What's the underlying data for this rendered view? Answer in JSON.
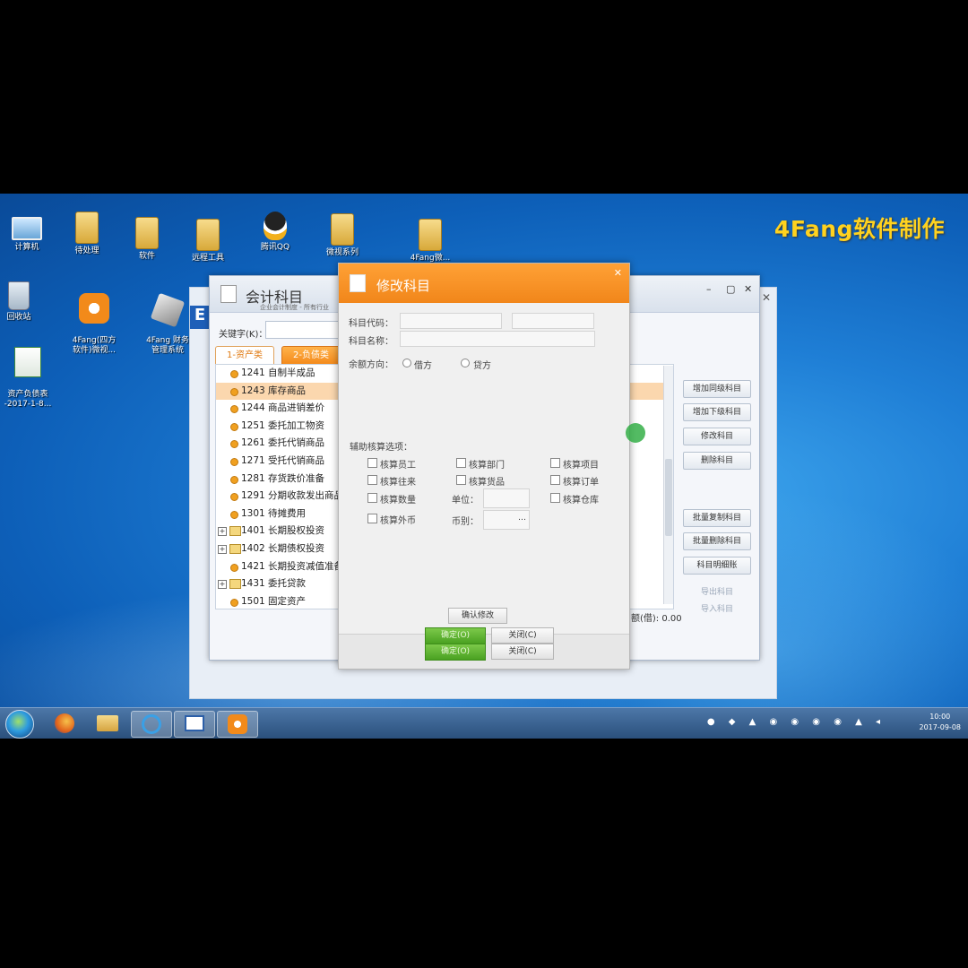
{
  "watermark": "4Fang软件制作",
  "desktop_icons": [
    {
      "label": "计算机",
      "icon": "computer-icon"
    },
    {
      "label": "待处理",
      "icon": "folder-icon"
    },
    {
      "label": "软件",
      "icon": "folder-icon"
    },
    {
      "label": "远程工具",
      "icon": "folder-icon"
    },
    {
      "label": "腾讯QQ",
      "icon": "qq-icon"
    },
    {
      "label": "微视系列",
      "icon": "folder-icon"
    },
    {
      "label": "4Fang微...",
      "icon": "folder-icon"
    },
    {
      "label": "回收站",
      "icon": "recycle-bin-icon"
    },
    {
      "label": "4Fang(四方\n软件)微视...",
      "icon": "app-icon"
    },
    {
      "label": "4Fang 财务\n管理系统",
      "icon": "app-icon"
    },
    {
      "label": "资产负债表\n-2017-1-8...",
      "icon": "excel-icon"
    }
  ],
  "main_window": {
    "title": "会计科目",
    "subtitle": "企业会计制度 - 所有行业",
    "keyword_label": "关键字(K)：",
    "tabs": [
      "1-资产类",
      "2-负债类"
    ],
    "rows": [
      {
        "code_name": "1241 自制半成品",
        "type": "leaf"
      },
      {
        "code_name": "1243 库存商品",
        "type": "leaf",
        "selected": true
      },
      {
        "code_name": "1244 商品进销差价",
        "type": "leaf"
      },
      {
        "code_name": "1251 委托加工物资",
        "type": "leaf"
      },
      {
        "code_name": "1261 委托代销商品",
        "type": "leaf"
      },
      {
        "code_name": "1271 受托代销商品",
        "type": "leaf"
      },
      {
        "code_name": "1281 存货跌价准备",
        "type": "leaf"
      },
      {
        "code_name": "1291 分期收款发出商品",
        "type": "leaf"
      },
      {
        "code_name": "1301 待摊费用",
        "type": "leaf"
      },
      {
        "code_name": "1401 长期股权投资",
        "type": "folder"
      },
      {
        "code_name": "1402 长期债权投资",
        "type": "folder"
      },
      {
        "code_name": "1421 长期投资减值准备",
        "type": "leaf"
      },
      {
        "code_name": "1431 委托贷款",
        "type": "folder"
      },
      {
        "code_name": "1501 固定资产",
        "type": "leaf"
      }
    ],
    "buttons": [
      "增加同级科目",
      "增加下级科目",
      "修改科目",
      "删除科目",
      "批量复制科目",
      "批量删除科目",
      "科目明细账"
    ],
    "links": [
      "导出科目",
      "导入科目"
    ],
    "total": "额(借): 0.00"
  },
  "dialog": {
    "title": "修改科目",
    "code_label": "科目代码：",
    "name_label": "科目名称：",
    "direction_label": "余额方向：",
    "debit": "借方",
    "credit": "贷方",
    "aux_label": "辅助核算选项：",
    "options": [
      "核算员工",
      "核算部门",
      "核算项目",
      "核算往来",
      "核算货品",
      "核算订单",
      "核算数量",
      "核算仓库",
      "核算外币"
    ],
    "unit_label": "单位：",
    "currency_label": "币别：",
    "confirm_edit": "确认修改",
    "ok": "确定(O)",
    "close": "关闭(C)"
  },
  "taskbar": {
    "time": "10:00",
    "date": "2017-09-08"
  }
}
